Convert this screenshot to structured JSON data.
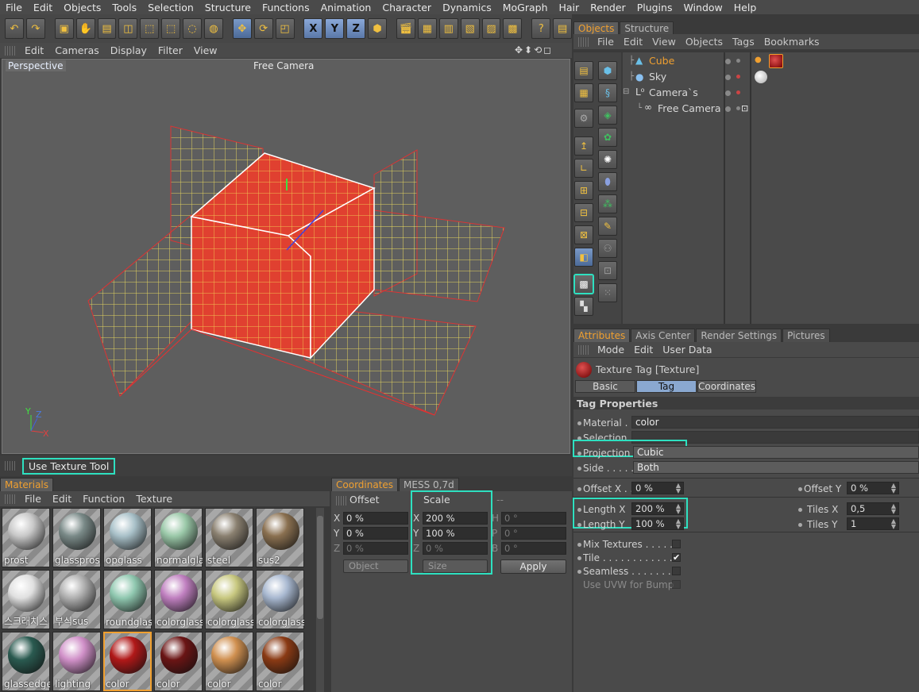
{
  "menubar": [
    "File",
    "Edit",
    "Objects",
    "Tools",
    "Selection",
    "Structure",
    "Functions",
    "Animation",
    "Character",
    "Dynamics",
    "MoGraph",
    "Hair",
    "Render",
    "Plugins",
    "Window",
    "Help"
  ],
  "axis_buttons": [
    "X",
    "Y",
    "Z"
  ],
  "viewport": {
    "menu": [
      "Edit",
      "Cameras",
      "Display",
      "Filter",
      "View"
    ],
    "label": "Perspective",
    "camera_label": "Free Camera",
    "status": "Use Texture Tool",
    "axis_labels": {
      "y": "Y",
      "z": "Z",
      "x": "X"
    }
  },
  "materials": {
    "tab": "Materials",
    "menu": [
      "File",
      "Edit",
      "Function",
      "Texture"
    ],
    "items": [
      {
        "name": "prost",
        "color": "#c8c8c8"
      },
      {
        "name": "glasspros",
        "color": "#7a8a88"
      },
      {
        "name": "opglass",
        "color": "#a8c0c8"
      },
      {
        "name": "normalgla",
        "color": "#9ac8a8"
      },
      {
        "name": "steel",
        "color": "#8a8070"
      },
      {
        "name": "sus2",
        "color": "#8a7050"
      },
      {
        "name": "스크래치스",
        "color": "#e0e0e0"
      },
      {
        "name": "부식sus",
        "color": "#b0b0b0"
      },
      {
        "name": "roundglas",
        "color": "#90c8b0"
      },
      {
        "name": "colorglass",
        "color": "#c080c0"
      },
      {
        "name": "colorglass",
        "color": "#c8c880"
      },
      {
        "name": "colorglass",
        "color": "#a8b8d0"
      },
      {
        "name": "glassedge",
        "color": "#2a5a50"
      },
      {
        "name": "lighting",
        "color": "#d090c8"
      },
      {
        "name": "color",
        "color": "#b01818"
      },
      {
        "name": "color",
        "color": "#6a1414"
      },
      {
        "name": "color",
        "color": "#d09050"
      },
      {
        "name": "color",
        "color": "#8a3a14"
      }
    ]
  },
  "coordinates": {
    "tabs": [
      "Coordinates",
      "MESS 0,7d"
    ],
    "offset_header": "Offset",
    "scale_header": "Scale",
    "rot_header": "--",
    "offset": [
      {
        "axis": "X",
        "value": "0 %"
      },
      {
        "axis": "Y",
        "value": "0 %"
      },
      {
        "axis": "Z",
        "value": "0 %"
      }
    ],
    "scale": [
      {
        "axis": "X",
        "value": "200 %"
      },
      {
        "axis": "Y",
        "value": "100 %"
      },
      {
        "axis": "Z",
        "value": "0 %"
      }
    ],
    "rotation": [
      {
        "axis": "H",
        "value": "0 °"
      },
      {
        "axis": "P",
        "value": "0 °"
      },
      {
        "axis": "B",
        "value": "0 °"
      }
    ],
    "object_dropdown": "Object",
    "size_dropdown": "Size",
    "apply": "Apply"
  },
  "objects": {
    "tabs": [
      "Objects",
      "Structure"
    ],
    "menu": [
      "File",
      "Edit",
      "View",
      "Objects",
      "Tags",
      "Bookmarks"
    ],
    "rows": [
      {
        "name": "Cube",
        "selected": true
      },
      {
        "name": "Sky",
        "selected": false
      },
      {
        "name": "Camera`s",
        "selected": false
      },
      {
        "name": "Free Camera",
        "selected": false
      }
    ]
  },
  "attributes": {
    "tabs": [
      "Attributes",
      "Axis Center",
      "Render Settings",
      "Pictures"
    ],
    "menu": [
      "Mode",
      "Edit",
      "User Data"
    ],
    "title": "Texture Tag [Texture]",
    "subtabs": [
      "Basic",
      "Tag",
      "Coordinates"
    ],
    "section": "Tag Properties",
    "material_label": "Material . .",
    "material_value": "color",
    "selection_label": "Selection",
    "projection_label": "Projection",
    "projection_value": "Cubic",
    "side_label": "Side . . . . .",
    "side_value": "Both",
    "offset_x_label": "Offset X . .",
    "offset_x_value": "0 %",
    "offset_y_label": "Offset Y",
    "offset_y_value": "0 %",
    "length_x_label": "Length X",
    "length_x_value": "200 %",
    "length_y_label": "Length Y",
    "length_y_value": "100 %",
    "tiles_x_label": "Tiles X",
    "tiles_x_value": "0,5",
    "tiles_y_label": "Tiles Y",
    "tiles_y_value": "1",
    "mix_label": "Mix Textures . . . . .",
    "tile_label": "Tile . . . . . . . . . . . . .",
    "seamless_label": "Seamless . . . . . . . .",
    "uvw_label": "Use UVW for Bump",
    "tile_check": "✔"
  }
}
